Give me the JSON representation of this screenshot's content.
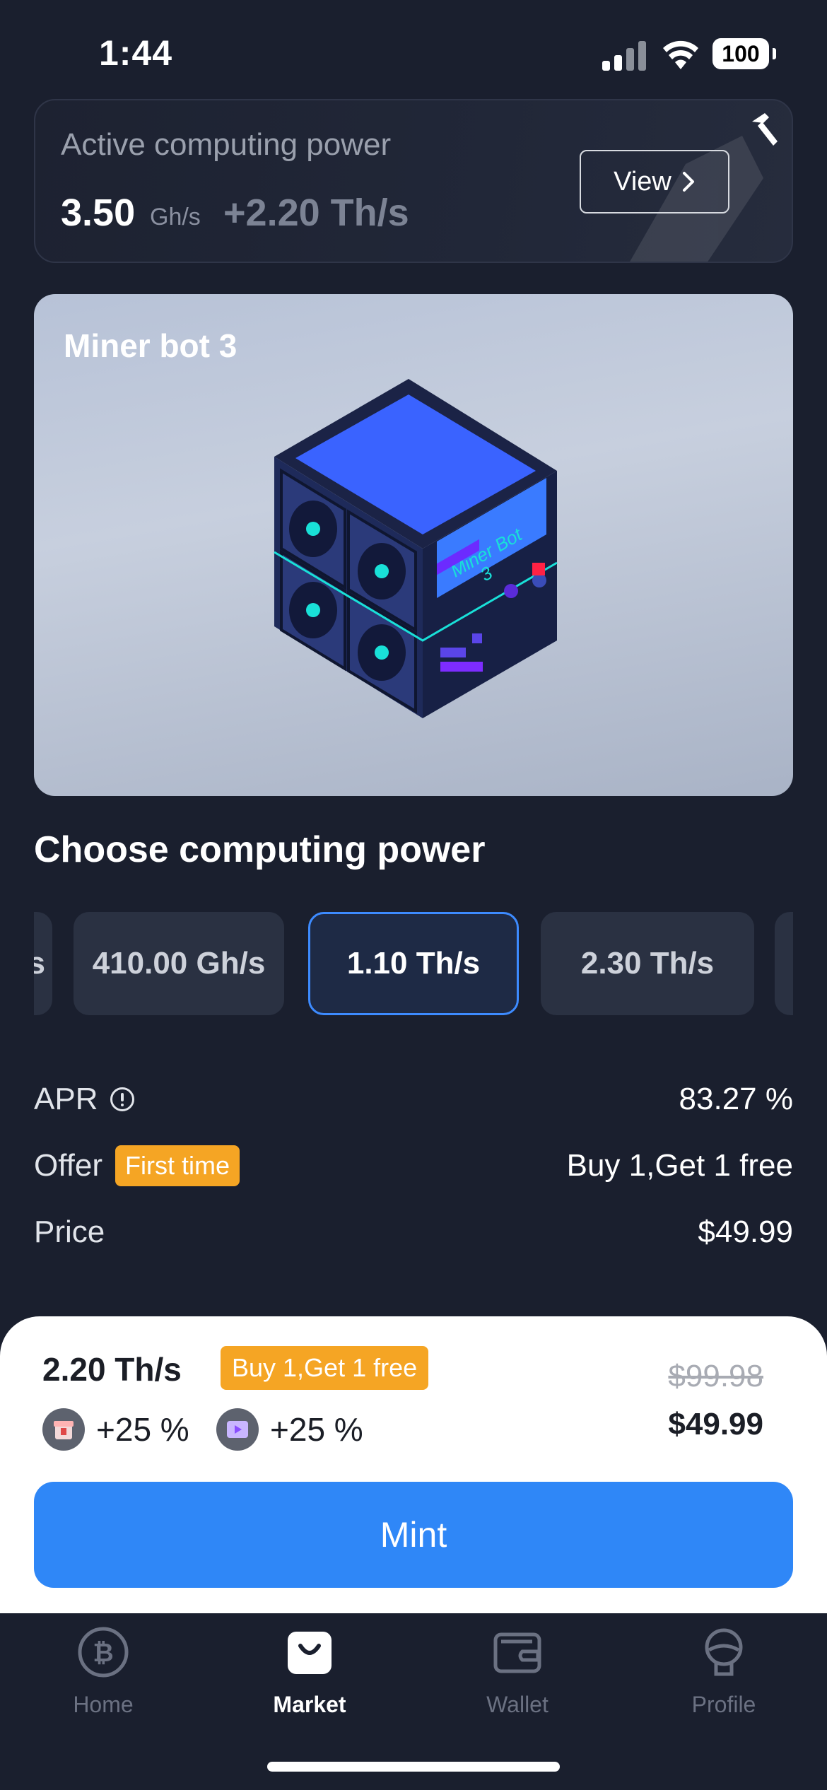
{
  "status_bar": {
    "time": "1:44",
    "battery": "100"
  },
  "power_card": {
    "label": "Active computing power",
    "value": "3.50",
    "unit": "Gh/s",
    "bonus": "+2.20 Th/s",
    "view_label": "View"
  },
  "hero": {
    "title": "Miner bot 3",
    "screen_text_line1": "Miner Bot",
    "screen_text_line2": "3"
  },
  "section_title": "Choose computing power",
  "chips": [
    {
      "label": "s"
    },
    {
      "label": "410.00 Gh/s"
    },
    {
      "label": "1.10 Th/s",
      "selected": true
    },
    {
      "label": "2.30 Th/s"
    },
    {
      "label": ""
    }
  ],
  "info": {
    "apr_label": "APR",
    "apr_value": "83.27 %",
    "offer_label": "Offer",
    "offer_badge": "First time",
    "offer_value": "Buy 1,Get 1 free",
    "price_label": "Price",
    "price_value": "$49.99"
  },
  "sheet": {
    "power": "2.20 Th/s",
    "badge": "Buy 1,Get 1 free",
    "boost1": "+25 %",
    "boost2": "+25 %",
    "old_price": "$99.98",
    "new_price": "$49.99",
    "mint_label": "Mint"
  },
  "tabs": [
    {
      "label": "Home",
      "icon": "bitcoin-icon"
    },
    {
      "label": "Market",
      "icon": "shopping-bag-icon",
      "active": true
    },
    {
      "label": "Wallet",
      "icon": "wallet-icon"
    },
    {
      "label": "Profile",
      "icon": "profile-icon"
    }
  ],
  "colors": {
    "accent": "#2f87f7",
    "badge": "#f5a524",
    "background": "#1a1f2e",
    "chip": "#2a3142"
  }
}
